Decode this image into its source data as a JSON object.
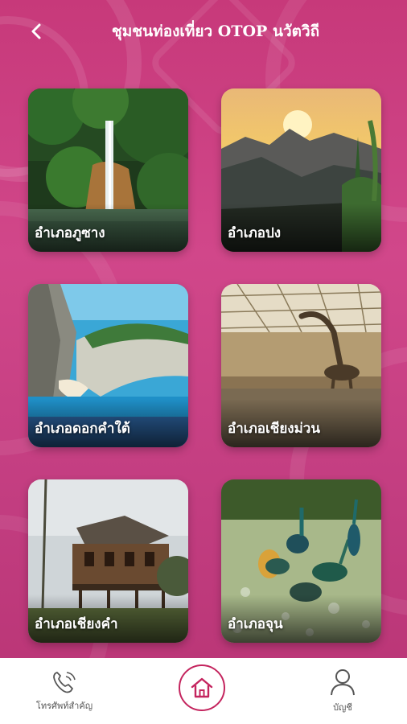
{
  "header": {
    "title": "ชุมชนท่องเที่ยว OTOP นวัตวิถี"
  },
  "cards": [
    {
      "label": "อำเภอภูซาง",
      "scene": "waterfall"
    },
    {
      "label": "อำเภอปง",
      "scene": "sunset-mountains"
    },
    {
      "label": "อำเภอดอกคำใต้",
      "scene": "cliff-beach"
    },
    {
      "label": "อำเภอเชียงม่วน",
      "scene": "dinosaur-museum"
    },
    {
      "label": "อำเภอเชียงคำ",
      "scene": "wooden-house"
    },
    {
      "label": "อำเภอจุน",
      "scene": "peacocks"
    }
  ],
  "nav": {
    "left_label": "โทรศัพท์สำคัญ",
    "right_label": "บัญชี",
    "left_icon": "phone-icon",
    "center_icon": "home-icon",
    "right_icon": "user-icon"
  },
  "colors": {
    "background": "#c7397a",
    "accent": "#c4245e"
  }
}
